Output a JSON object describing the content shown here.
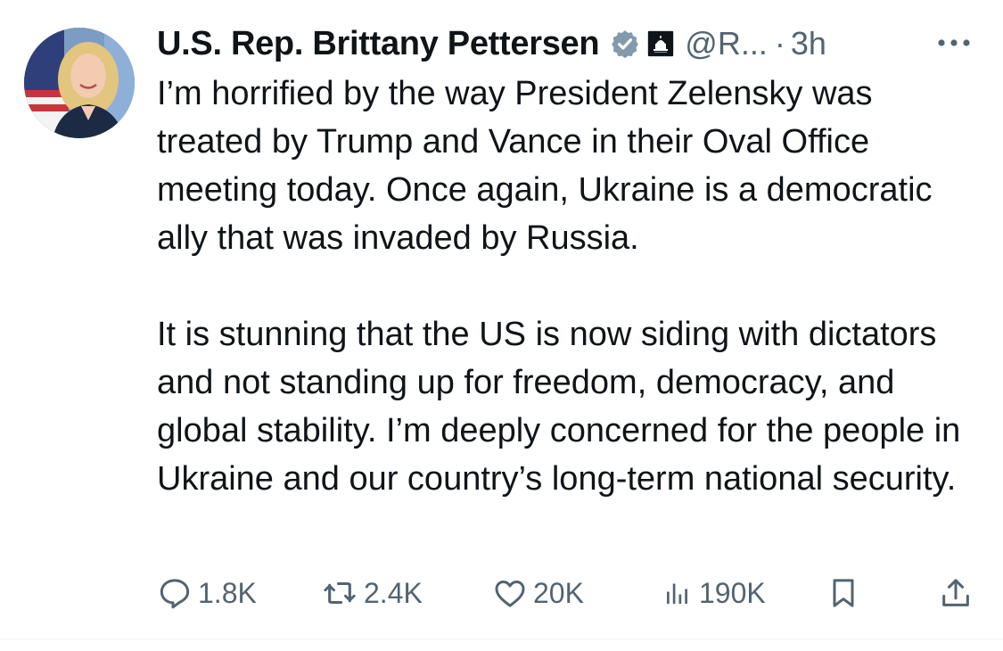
{
  "tweet": {
    "author": {
      "display_name": "U.S. Rep. Brittany Pettersen",
      "handle": "@R...",
      "verified_icon": "verified-badge-icon",
      "affiliate_icon": "capitol-affiliate-icon"
    },
    "separator": "·",
    "time": "3h",
    "more_icon": "more-dots-icon",
    "paragraphs": [
      "I’m horrified by the way President Zelensky was treated by Trump and Vance in their Oval Office meeting today. Once again, Ukraine is a democratic ally that was invaded by Russia.",
      "It is stunning that the US is now siding with dictators and not standing up for freedom, democracy, and global stability. I’m deeply concerned for the people in Ukraine and our country’s long-term national security."
    ],
    "actions": {
      "replies": {
        "icon": "reply-icon",
        "count": "1.8K"
      },
      "reposts": {
        "icon": "repost-icon",
        "count": "2.4K"
      },
      "likes": {
        "icon": "heart-icon",
        "count": "20K"
      },
      "views": {
        "icon": "views-chart-icon",
        "count": "190K"
      },
      "bookmark": {
        "icon": "bookmark-icon"
      },
      "share": {
        "icon": "share-icon"
      }
    }
  },
  "colors": {
    "text_primary": "#0f1419",
    "text_secondary": "#536471",
    "verified_badge": "#829aab",
    "divider": "#eff3f4"
  }
}
